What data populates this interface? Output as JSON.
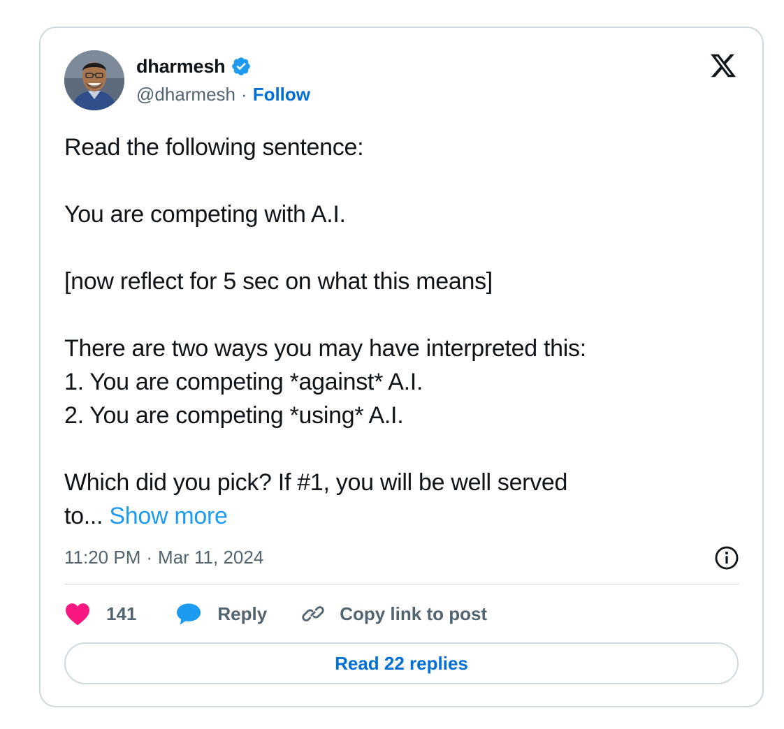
{
  "author": {
    "display_name": "dharmesh",
    "handle": "@dharmesh",
    "separator": "·",
    "follow_label": "Follow"
  },
  "tweet": {
    "lines": [
      "Read the following sentence:",
      "",
      "You are competing with A.I.",
      "",
      "[now reflect for 5 sec on what this means]",
      "",
      "There are two ways you may have interpreted this:",
      "1. You are competing *against* A.I.",
      "2. You are competing *using* A.I.",
      "",
      "Which did you pick? If #1, you will be well served"
    ],
    "last_line_prefix": "to...",
    "show_more_label": "Show more"
  },
  "meta": {
    "time": "11:20 PM",
    "separator": "·",
    "date": "Mar 11, 2024"
  },
  "actions": {
    "like_count": "141",
    "reply_label": "Reply",
    "copy_link_label": "Copy link to post"
  },
  "read_replies_label": "Read 22 replies",
  "colors": {
    "text": "#0f1419",
    "secondary": "#536471",
    "link": "#006fd6",
    "show_more": "#1d9bf0",
    "like": "#f91880",
    "reply": "#1d9bf0",
    "verified": "#1d9bf0",
    "border": "#cfd9de"
  },
  "icons": {
    "verified": "verified-badge-icon",
    "logo": "x-logo-icon",
    "info": "info-icon",
    "like": "heart-icon",
    "reply": "speech-bubble-icon",
    "copy_link": "link-icon"
  }
}
